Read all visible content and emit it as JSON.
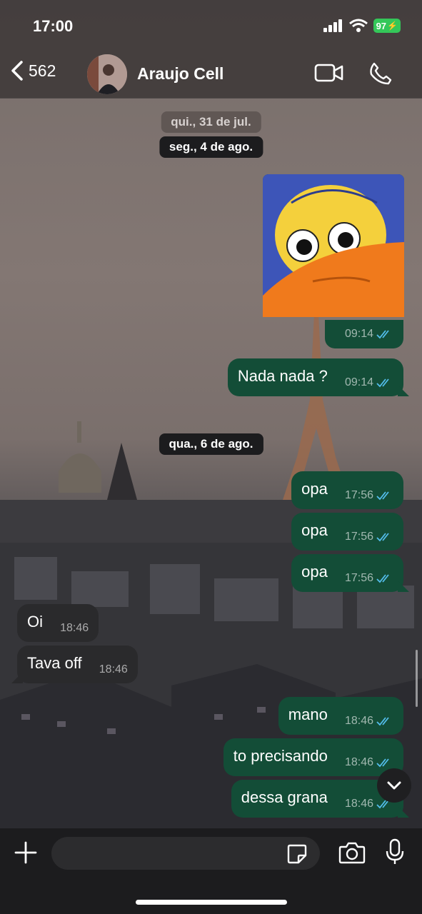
{
  "status_bar": {
    "time": "17:00",
    "battery": "97"
  },
  "header": {
    "back_count": "562",
    "contact_name": "Araujo Cell"
  },
  "dates": [
    "qui., 31 de jul.",
    "seg., 4 de ago.",
    "qua., 6 de ago."
  ],
  "image_message": {
    "time": "09:14"
  },
  "messages": [
    {
      "dir": "out",
      "text": "Nada nada ?",
      "time": "09:14"
    },
    {
      "dir": "out",
      "text": "opa",
      "time": "17:56"
    },
    {
      "dir": "out",
      "text": "opa",
      "time": "17:56"
    },
    {
      "dir": "out",
      "text": "opa",
      "time": "17:56"
    },
    {
      "dir": "in",
      "text": "Oi",
      "time": "18:46"
    },
    {
      "dir": "in",
      "text": "Tava off",
      "time": "18:46"
    },
    {
      "dir": "out",
      "text": "mano",
      "time": "18:46"
    },
    {
      "dir": "out",
      "text": "to precisando",
      "time": "18:46"
    },
    {
      "dir": "out",
      "text": "dessa grana",
      "time": "18:46"
    }
  ],
  "composer": {
    "placeholder": ""
  },
  "colors": {
    "outgoing": "#134d37",
    "incoming": "#2a2a2c",
    "read_ticks": "#53bdeb",
    "battery": "#34c759"
  }
}
